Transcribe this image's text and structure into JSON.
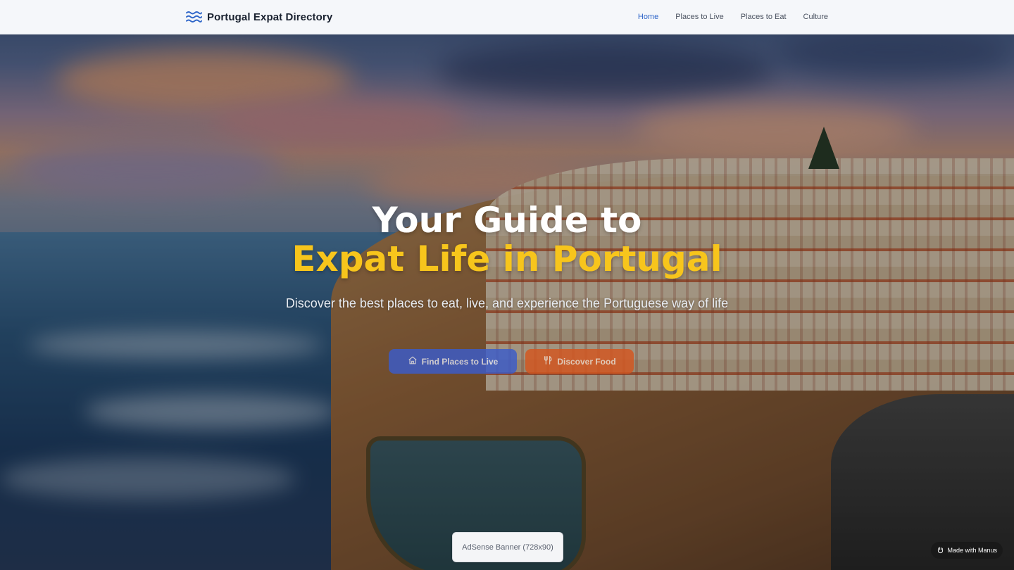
{
  "header": {
    "brand_title": "Portugal Expat Directory",
    "brand_icon": "waves-icon",
    "nav": [
      {
        "label": "Home",
        "active": true
      },
      {
        "label": "Places to Live",
        "active": false
      },
      {
        "label": "Places to Eat",
        "active": false
      },
      {
        "label": "Culture",
        "active": false
      }
    ]
  },
  "hero": {
    "headline_line1": "Your Guide to",
    "headline_line2": "Expat Life in Portugal",
    "subtitle": "Discover the best places to eat, live, and experience the Portuguese way of life",
    "buttons": {
      "primary_label": "Find Places to Live",
      "primary_icon": "home-icon",
      "secondary_label": "Discover Food",
      "secondary_icon": "utensils-icon"
    }
  },
  "ad_banner": {
    "label": "AdSense Banner (728x90)"
  },
  "badge": {
    "label": "Made with Manus",
    "icon": "manus-hand-icon"
  },
  "colors": {
    "accent_blue": "#2f66c9",
    "headline_yellow": "#f7c51c",
    "button_blue": "#3b5ccb",
    "button_orange": "#d4561f",
    "header_bg": "#f5f7fa"
  }
}
